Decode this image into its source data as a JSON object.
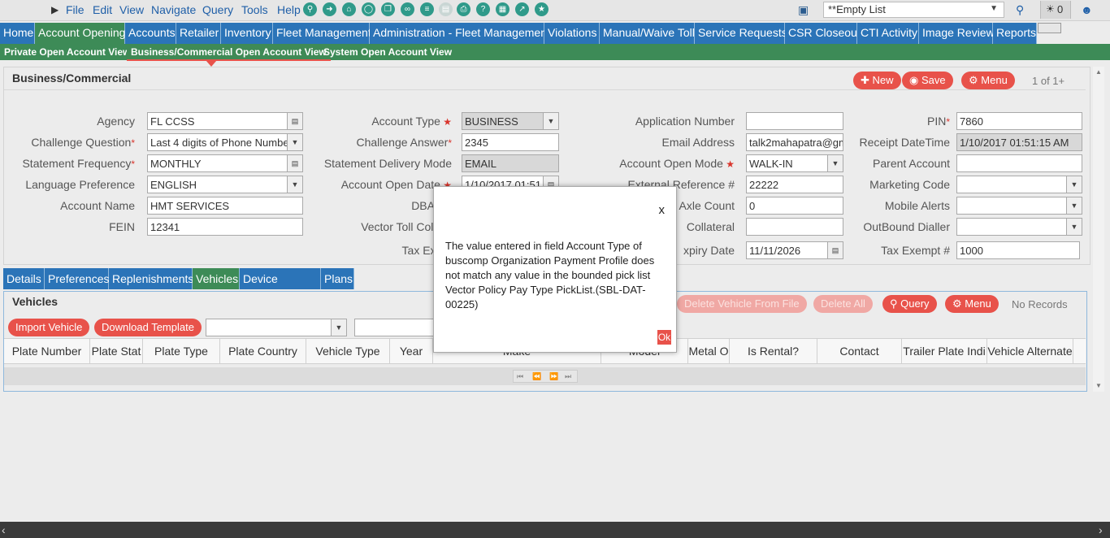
{
  "menubar": {
    "items": [
      "File",
      "Edit",
      "View",
      "Navigate",
      "Query",
      "Tools",
      "Help"
    ],
    "empty_list": "**Empty List",
    "notifications": "0"
  },
  "nav": {
    "tabs": [
      "Home",
      "Account Opening",
      "Accounts",
      "Retailer",
      "Inventory",
      "Fleet Management",
      "Administration - Fleet Management",
      "Violations",
      "Manual/Waive Toll",
      "Service Requests",
      "CSR Closeout",
      "CTI Activity",
      "Image Review",
      "Reports"
    ],
    "sub_tabs": [
      "Private Open Account View",
      "Business/Commercial Open Account View",
      "System Open Account View"
    ]
  },
  "form": {
    "title": "Business/Commercial",
    "new_label": "New",
    "save_label": "Save",
    "menu_label": "Menu",
    "record_count": "1 of 1+",
    "labels": {
      "agency": "Agency",
      "challenge_question": "Challenge Question",
      "statement_frequency": "Statement Frequency",
      "language_preference": "Language Preference",
      "account_name": "Account Name",
      "fein": "FEIN",
      "account_type": "Account Type",
      "challenge_answer": "Challenge Answer",
      "statement_delivery_mode": "Statement Delivery Mode",
      "account_open_date": "Account Open Date",
      "dba_name": "DBA Na",
      "vector_toll_collateral": "Vector Toll Collate",
      "tax_exempt": "Tax Exem",
      "application_number": "Application Number",
      "email_address": "Email Address",
      "account_open_mode": "Account Open Mode",
      "external_reference": "External Reference #",
      "axle_count": "Axle Count",
      "collateral": "Collateral",
      "expiry_date": "xpiry Date",
      "pin": "PIN",
      "receipt_datetime": "Receipt DateTime",
      "parent_account": "Parent Account",
      "marketing_code": "Marketing Code",
      "mobile_alerts": "Mobile Alerts",
      "outbound_dialler": "OutBound Dialler",
      "tax_exempt_no": "Tax Exempt #"
    },
    "values": {
      "agency": "FL CCSS",
      "challenge_question": "Last 4 digits of Phone Number",
      "statement_frequency": "MONTHLY",
      "language_preference": "ENGLISH",
      "account_name": "HMT SERVICES",
      "fein": "12341",
      "account_type": "BUSINESS",
      "challenge_answer": "2345",
      "statement_delivery_mode": "EMAIL",
      "account_open_date": "1/10/2017 01:51",
      "application_number": "",
      "email_address": "talk2mahapatra@gm",
      "account_open_mode": "WALK-IN",
      "external_reference": "22222",
      "axle_count": "0",
      "collateral": "",
      "expiry_date": "11/11/2026",
      "pin": "7860",
      "receipt_datetime": "1/10/2017 01:51:15 AM",
      "parent_account": "",
      "marketing_code": "",
      "mobile_alerts": "",
      "outbound_dialler": "",
      "tax_exempt_no": "1000"
    }
  },
  "detail_tabs": [
    "Details",
    "Preferences",
    "Replenishments",
    "Vehicles",
    "Device Request",
    "Plans"
  ],
  "vehicles": {
    "title": "Vehicles",
    "import_label": "Import Vehicle",
    "download_label": "Download Template",
    "delete_from_file_label": "Delete Vehicle From File",
    "delete_all_label": "Delete All",
    "query_label": "Query",
    "menu_label": "Menu",
    "no_records": "No Records",
    "columns": [
      "Plate Number",
      "Plate Stat",
      "Plate Type",
      "Plate Country",
      "Vehicle Type",
      "Year",
      "Make",
      "Model",
      "Metal O",
      "Is Rental?",
      "Contact",
      "Trailer Plate Indi",
      "Vehicle Alternate"
    ]
  },
  "modal": {
    "close": "x",
    "message": "The value entered in field Account Type of buscomp Organization Payment Profile does not match any value in the bounded pick list Vector Policy Pay Type PickList.(SBL-DAT-00225)",
    "ok": "Ok"
  },
  "colors": {
    "nav_blue": "#2b74b8",
    "nav_green": "#3d8b57",
    "accent_red": "#e8524a",
    "icon_teal": "#2f9a8a"
  }
}
